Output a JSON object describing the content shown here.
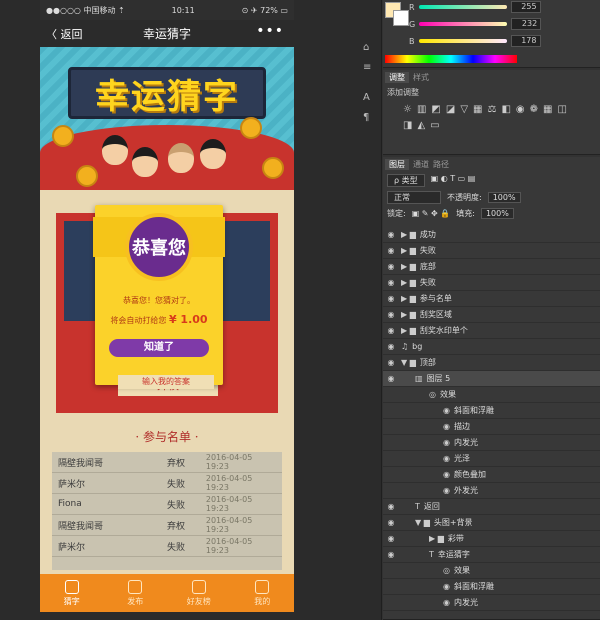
{
  "phone": {
    "status": {
      "carrier": "●●○○○ 中国移动 ⇡",
      "time": "10:11",
      "right": "⊙ ✈ 72% ▭"
    },
    "nav": {
      "back": "〈 返回",
      "title": "幸运猜字",
      "more": "•••"
    },
    "banner": {
      "title": "幸运猜字"
    },
    "modal": {
      "title": "恭喜您",
      "line1": "恭喜您！您猜对了。",
      "line2_prefix": "将会自动打给您",
      "amount": "¥ 1.00",
      "button": "知道了",
      "under": "输入我的答案"
    },
    "prize": {
      "button": "弃权"
    },
    "list_title": "· 参与名单 ·",
    "records": [
      {
        "name": "隔壁我闻哥",
        "result": "弃权",
        "time": "2016-04-05 19:23"
      },
      {
        "name": "萨米尔",
        "result": "失败",
        "time": "2016-04-05 19:23"
      },
      {
        "name": "Fiona",
        "result": "失败",
        "time": "2016-04-05 19:23"
      },
      {
        "name": "隔壁我闻哥",
        "result": "弃权",
        "time": "2016-04-05 19:23"
      },
      {
        "name": "萨米尔",
        "result": "失败",
        "time": "2016-04-05 19:23"
      }
    ],
    "tabs": [
      {
        "label": "猜字",
        "icon": "puzzle-icon",
        "active": true
      },
      {
        "label": "发布",
        "icon": "pencil-icon",
        "active": false
      },
      {
        "label": "好友榜",
        "icon": "friends-icon",
        "active": false
      },
      {
        "label": "我的",
        "icon": "user-icon",
        "active": false
      }
    ]
  },
  "ps": {
    "color": {
      "r": "255",
      "g": "232",
      "b": "178"
    },
    "panel_tabs": [
      "调整",
      "样式"
    ],
    "adjust_title": "添加调整",
    "layer_tabs": [
      "图层",
      "通道",
      "路径"
    ],
    "filter_label": "ρ 类型",
    "blend_mode": "正常",
    "opacity_label": "不透明度:",
    "opacity": "100%",
    "lock_label": "锁定:",
    "fill_label": "填充:",
    "fill": "100%",
    "layers": [
      {
        "label": "成功",
        "type": "folder",
        "depth": 0
      },
      {
        "label": "失败",
        "type": "folder",
        "depth": 0
      },
      {
        "label": "底部",
        "type": "folder",
        "depth": 0
      },
      {
        "label": "失败",
        "type": "folder",
        "depth": 0
      },
      {
        "label": "参与名单",
        "type": "folder",
        "depth": 0
      },
      {
        "label": "刮奖区域",
        "type": "folder",
        "depth": 0
      },
      {
        "label": "刮奖水印单个",
        "type": "folder",
        "depth": 0
      },
      {
        "label": "bg",
        "type": "image",
        "depth": 0
      },
      {
        "label": "顶部",
        "type": "folder-open",
        "depth": 0
      },
      {
        "label": "图层 5",
        "type": "layer",
        "depth": 1
      },
      {
        "label": "效果",
        "type": "effects",
        "depth": 2
      },
      {
        "label": "斜面和浮雕",
        "type": "effect",
        "depth": 3
      },
      {
        "label": "描边",
        "type": "effect",
        "depth": 3
      },
      {
        "label": "内发光",
        "type": "effect",
        "depth": 3
      },
      {
        "label": "光泽",
        "type": "effect",
        "depth": 3
      },
      {
        "label": "颜色叠加",
        "type": "effect",
        "depth": 3
      },
      {
        "label": "外发光",
        "type": "effect",
        "depth": 3
      },
      {
        "label": "返回",
        "type": "text",
        "depth": 1
      },
      {
        "label": "头图+背景",
        "type": "folder-open",
        "depth": 1
      },
      {
        "label": "彩带",
        "type": "folder",
        "depth": 2
      },
      {
        "label": "幸运猜字",
        "type": "text",
        "depth": 2
      },
      {
        "label": "效果",
        "type": "effects",
        "depth": 3
      },
      {
        "label": "斜面和浮雕",
        "type": "effect",
        "depth": 3
      },
      {
        "label": "内发光",
        "type": "effect",
        "depth": 3
      }
    ],
    "colors": {
      "foreground": "#ffe8b2",
      "background": "#ffffff"
    }
  }
}
